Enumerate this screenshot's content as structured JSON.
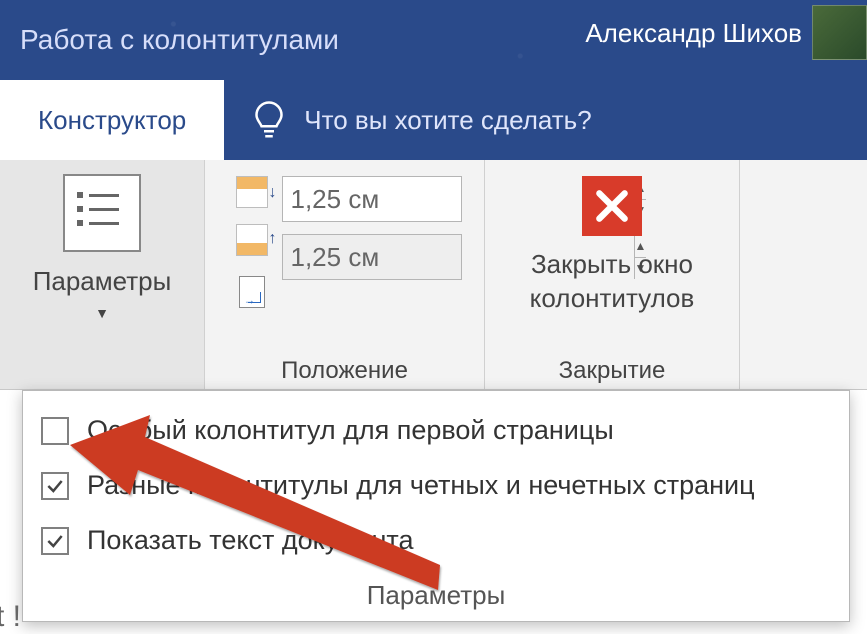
{
  "titlebar": {
    "title": "Работа с колонтитулами",
    "user_name": "Александр Шихов"
  },
  "tabs": {
    "design": "Конструктор",
    "tell_me": "Что вы хотите сделать?"
  },
  "ribbon": {
    "params_label": "Параметры",
    "position": {
      "top_value": "1,25 см",
      "bottom_value": "1,25 см",
      "group_label": "Положение"
    },
    "close": {
      "line1": "Закрыть окно",
      "line2": "колонтитулов",
      "group_label": "Закрытие"
    }
  },
  "dropdown": {
    "opt1": {
      "label": "Особый колонтитул для первой страницы",
      "checked": false
    },
    "opt2": {
      "label": "Разные колонтитулы для четных и нечетных страниц",
      "checked": true
    },
    "opt3": {
      "label": "Показать текст документа",
      "checked": true
    },
    "footer": "Параметры"
  },
  "doc_edge": "t !"
}
